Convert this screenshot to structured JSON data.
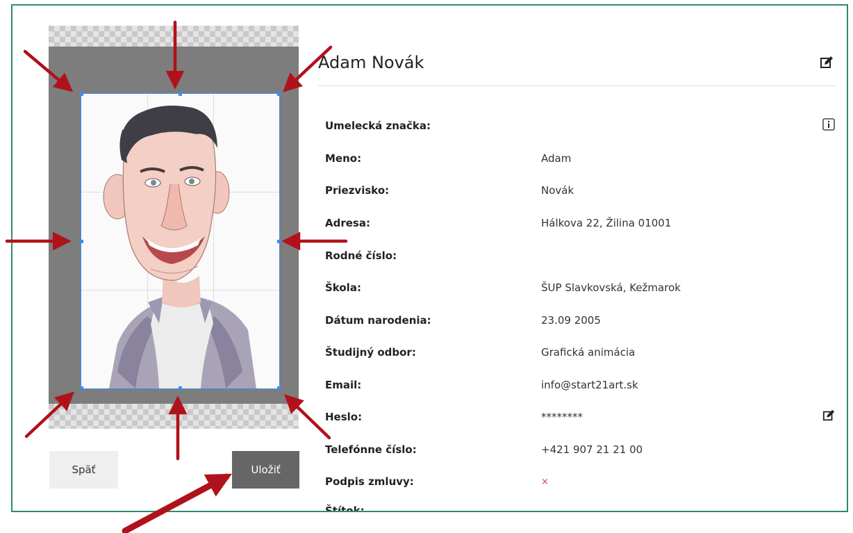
{
  "profile": {
    "name": "Adam Novák",
    "fields": [
      {
        "label": "Umelecká značka:",
        "value": "",
        "icon": "info-icon"
      },
      {
        "label": "Meno:",
        "value": "Adam"
      },
      {
        "label": "Priezvisko:",
        "value": "Novák"
      },
      {
        "label": "Adresa:",
        "value": "Hálkova 22, Žilina 01001"
      },
      {
        "label": "Rodné číslo:",
        "value": ""
      },
      {
        "label": "Škola:",
        "value": "ŠUP Slavkovská, Kežmarok"
      },
      {
        "label": "Dátum narodenia:",
        "value": "23.09 2005"
      },
      {
        "label": "Študijný odbor:",
        "value": "Grafická animácia"
      },
      {
        "label": "Email:",
        "value": "info@start21art.sk"
      },
      {
        "label": "Heslo:",
        "value": "********",
        "icon": "edit-icon"
      },
      {
        "label": "Telefónne číslo:",
        "value": "+421 907 21 21 00"
      },
      {
        "label": "Podpis zmluvy:",
        "value": "×"
      },
      {
        "label": "Štítok:",
        "value": "—"
      }
    ]
  },
  "buttons": {
    "back_label": "Späť",
    "save_label": "Uložiť"
  },
  "colors": {
    "frame_border": "#2e8a6e",
    "crop_outline": "#3d8bf2",
    "arrow": "#b0121b",
    "save_button": "#666666"
  }
}
